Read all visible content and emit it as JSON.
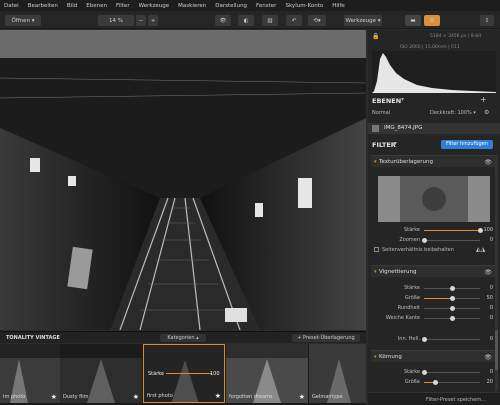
{
  "menu": [
    "Datei",
    "Bearbeiten",
    "Bild",
    "Ebenen",
    "Filter",
    "Werkzeuge",
    "Maskieren",
    "Darstellung",
    "Fenster",
    "Skylum-Konto",
    "Hilfe"
  ],
  "toolbar": {
    "open_label": "Öffnen ▾",
    "zoom_value": "14 %",
    "zoom_minus": "−",
    "zoom_plus": "+",
    "tools_label": "Werkzeuge ▾"
  },
  "filmstrip": {
    "preset_group": "TONALITY VINTAGE",
    "categories_label": "Kategorien ▴",
    "overlay_label": "+ Preset-Überlagerung",
    "thumbs": [
      {
        "label": "Im photo",
        "starred": true
      },
      {
        "label": "Dusty film",
        "starred": true
      },
      {
        "label": "first photo",
        "starred": true,
        "selected": true,
        "strength_label": "Stärke",
        "strength_value": "100"
      },
      {
        "label": "forgotten dreams",
        "starred": true
      },
      {
        "label": "Gelmantype",
        "starred": false
      }
    ]
  },
  "info": {
    "dims": "5184 × 3456 px  |  8-bit",
    "exif": "ISO 2000  |  15.00mm  |  f/11"
  },
  "layers": {
    "title": "EBENEN",
    "blend_mode": "Normal",
    "opacity_label": "Deckkraft: 100% ▾",
    "layer_name": "IMG_8474.JPG"
  },
  "filters": {
    "title": "FILTER",
    "add_button": "Filter hinzufügen",
    "texture": {
      "title": "Texturüberlagerung",
      "strength_label": "Stärke",
      "strength_value": "100",
      "strength_frac": 1.0,
      "zoom_label": "Zoomen",
      "zoom_value": "0",
      "zoom_frac": 0.0,
      "checkbox_label": "Seitenverhältnis beibehalten"
    },
    "vignette": {
      "title": "Vignettierung",
      "rows": [
        {
          "label": "Stärke",
          "value": "0",
          "frac": 0.5
        },
        {
          "label": "Größe",
          "value": "50",
          "frac": 0.5
        },
        {
          "label": "Rundheit",
          "value": "0",
          "frac": 0.5
        },
        {
          "label": "Weiche Kante",
          "value": "0",
          "frac": 0.5
        }
      ],
      "inner_label": "Inn. Hell.",
      "inner_value": "0",
      "inner_frac": 0.0
    },
    "grain": {
      "title": "Körnung",
      "rows": [
        {
          "label": "Stärke",
          "value": "0",
          "frac": 0.0
        },
        {
          "label": "Größe",
          "value": "20",
          "frac": 0.2
        }
      ]
    },
    "save_preset": "Filter-Preset speichern..."
  },
  "colors": {
    "accent": "#e08a2a",
    "blue_button": "#2f7fd6"
  }
}
